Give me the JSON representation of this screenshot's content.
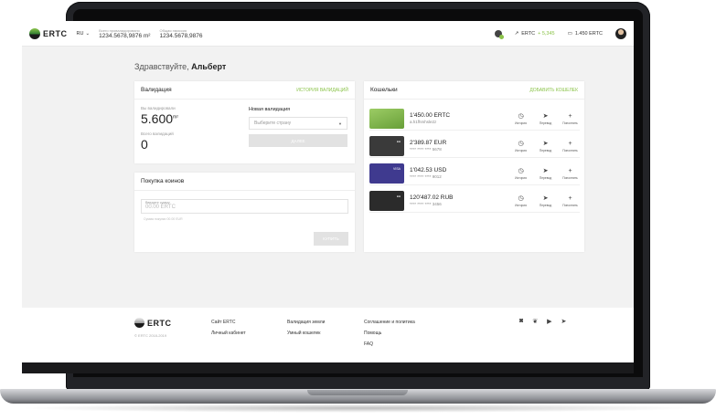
{
  "header": {
    "logo_text": "ERTC",
    "lang": "RU",
    "validated_label": "Всего провалидировано",
    "validated_value": "1234.5678,9876 m²",
    "emission_label": "Общая эмиссия",
    "emission_value": "1234.5678,9876",
    "rate_label": "ERTC",
    "rate_delta": "+ 5,345",
    "balance": "1.450 ERTC"
  },
  "greeting": {
    "hello": "Здравствуйте,",
    "name": "Альберт"
  },
  "validation": {
    "title": "Валидация",
    "history_link": "История валидаций",
    "validated_label": "Вы валидировали",
    "validated_value": "5.600",
    "validated_unit": "m²",
    "total_label": "Всего валидаций",
    "total_value": "0",
    "new_title": "Новая валидация",
    "country_placeholder": "Выберите страну",
    "next_button": "Далее"
  },
  "purchase": {
    "title": "Покупка коинов",
    "input_label": "Введите сумму",
    "input_placeholder": "00.00 ERTC",
    "hint": "Сумма покупки 00.00 EUR",
    "buy_button": "Купить"
  },
  "wallets": {
    "title": "Кошельки",
    "add_link": "Добавить кошелек",
    "action_labels": {
      "history": "История",
      "transfer": "Перевод",
      "topup": "Пополнить"
    },
    "items": [
      {
        "amount": "1'450.00 ERTC",
        "sub": "a.h1fhmhsle2z",
        "card_color": "#7cb342",
        "badge": ""
      },
      {
        "amount": "2'389.87 EUR",
        "sub": "**** **** **** 5678",
        "card_color": "#3a3a3a",
        "badge": "●●"
      },
      {
        "amount": "1'042.53 USD",
        "sub": "**** **** **** 9012",
        "card_color": "#3f3a8f",
        "badge": "VISA"
      },
      {
        "amount": "120'487.02 RUB",
        "sub": "**** **** **** 3456",
        "card_color": "#2b2b2b",
        "badge": "●●"
      }
    ]
  },
  "footer": {
    "logo_text": "ERTC",
    "copyright": "© ERTC 2018-2019",
    "col1": [
      "Сайт ERTC",
      "Личный кабинет"
    ],
    "col2": [
      "Валидация земли",
      "Умный кошелек"
    ],
    "col3": [
      "Соглашение и политика",
      "Помощь",
      "FAQ"
    ]
  }
}
